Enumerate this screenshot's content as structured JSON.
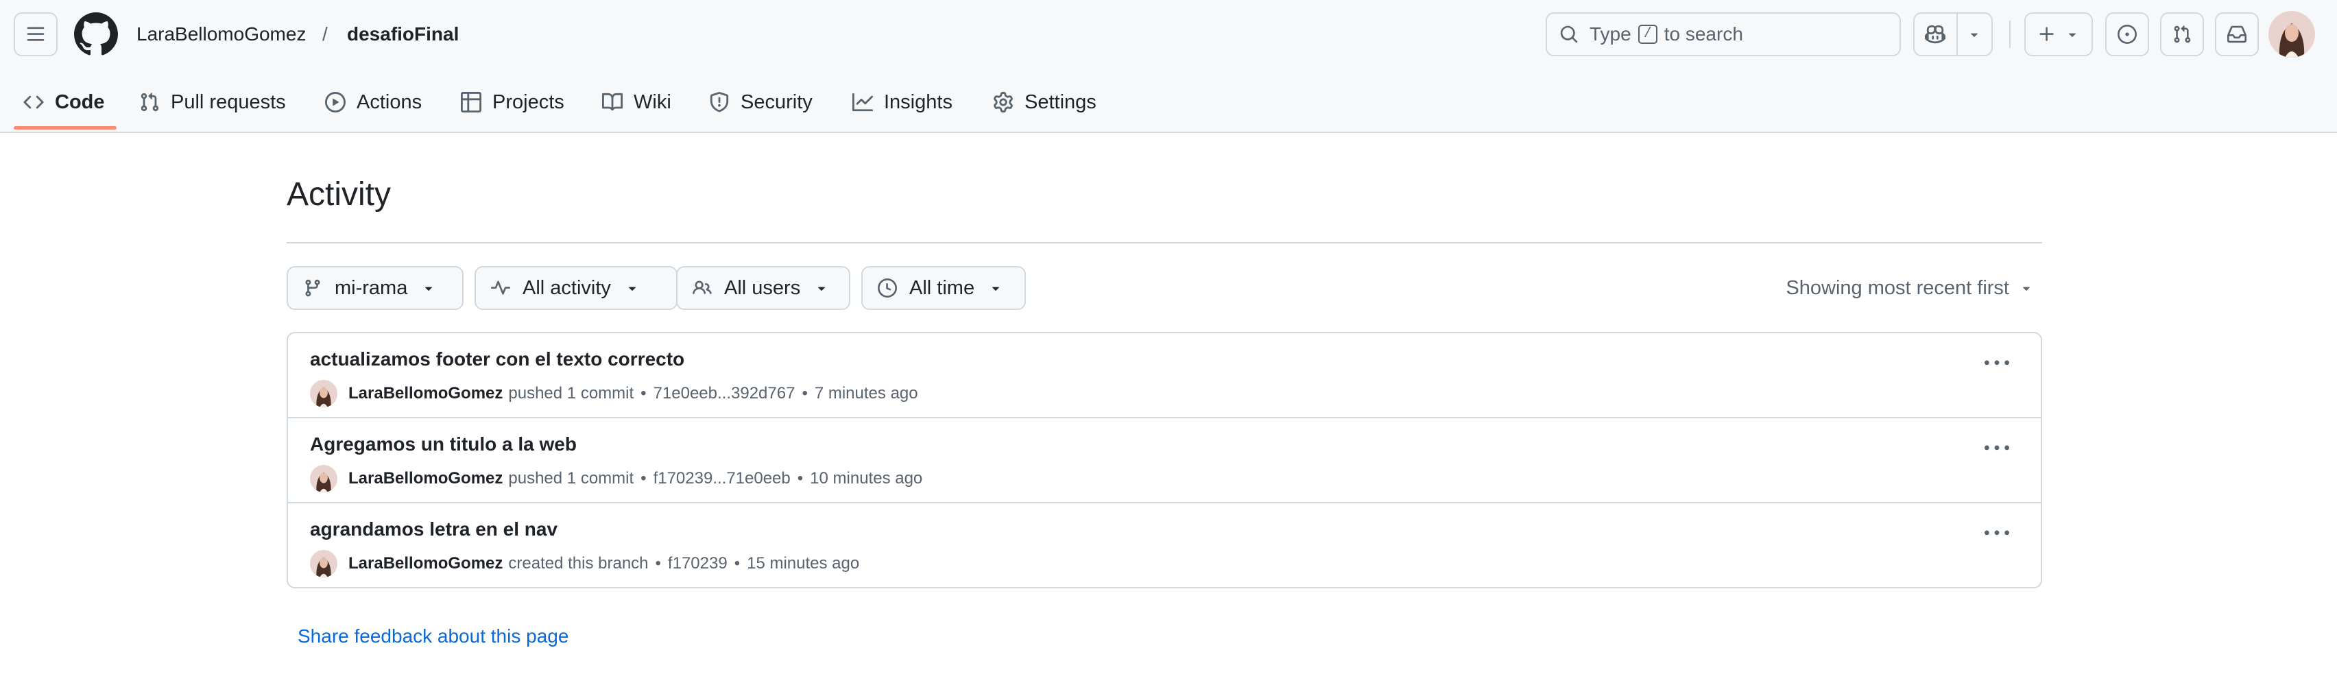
{
  "header": {
    "owner": "LaraBellomoGomez",
    "separator": "/",
    "repo": "desafioFinal",
    "search": {
      "prefix": "Type",
      "key": "/",
      "suffix": "to search"
    }
  },
  "nav": {
    "tabs": [
      {
        "label": "Code",
        "icon": "code-icon",
        "active": true
      },
      {
        "label": "Pull requests",
        "icon": "git-pull-request-icon"
      },
      {
        "label": "Actions",
        "icon": "play-icon"
      },
      {
        "label": "Projects",
        "icon": "table-icon"
      },
      {
        "label": "Wiki",
        "icon": "book-icon"
      },
      {
        "label": "Security",
        "icon": "shield-icon"
      },
      {
        "label": "Insights",
        "icon": "graph-icon"
      },
      {
        "label": "Settings",
        "icon": "gear-icon"
      }
    ]
  },
  "main": {
    "title": "Activity",
    "filters": {
      "branch": "mi-rama",
      "activity": "All activity",
      "users": "All users",
      "time": "All time"
    },
    "sort": "Showing most recent first",
    "feedback": "Share feedback about this page"
  },
  "activity": [
    {
      "title": "actualizamos footer con el texto correcto",
      "user": "LaraBellomoGomez",
      "action": "pushed 1 commit",
      "ref": "71e0eeb...392d767",
      "time": "7 minutes ago"
    },
    {
      "title": "Agregamos un titulo a la web",
      "user": "LaraBellomoGomez",
      "action": "pushed 1 commit",
      "ref": "f170239...71e0eeb",
      "time": "10 minutes ago"
    },
    {
      "title": "agrandamos letra en el nav",
      "user": "LaraBellomoGomez",
      "action": "created this branch",
      "ref": "f170239",
      "time": "15 minutes ago"
    }
  ],
  "meta_separator": "•",
  "colors": {
    "accent_underline": "#fd8c73",
    "link": "#0969da",
    "border": "#d1d9e0",
    "header_bg": "#f6f8fa"
  }
}
